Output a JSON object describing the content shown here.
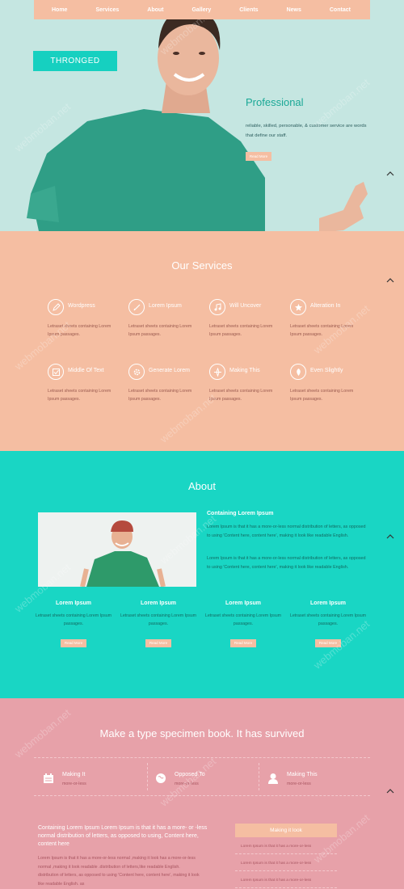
{
  "nav": [
    "Home",
    "Services",
    "About",
    "Gallery",
    "Clients",
    "News",
    "Contact"
  ],
  "hero": {
    "brand": "THRONGED",
    "title": "Professional",
    "text": "reliable, skilled, personable, & customer service are words that define our staff.",
    "button": "Read More"
  },
  "services": {
    "title": "Our Services",
    "items": [
      {
        "name": "Wordpress",
        "icon": "pencil-icon",
        "desc": "Letraset sheets containing Lorem Ipsum passages."
      },
      {
        "name": "Lorem Ipsum",
        "icon": "pen-icon",
        "desc": "Letraset sheets containing Lorem Ipsum passages."
      },
      {
        "name": "Will Uncover",
        "icon": "music-note-icon",
        "desc": "Letraset sheets containing Lorem Ipsum passages."
      },
      {
        "name": "Alteration In",
        "icon": "star-icon",
        "desc": "Letraset sheets containing Lorem Ipsum passages."
      },
      {
        "name": "Middle Of Text",
        "icon": "check-icon",
        "desc": "Letraset sheets containing Lorem Ipsum passages."
      },
      {
        "name": "Generate Lorem",
        "icon": "gear-icon",
        "desc": "Letraset sheets containing Lorem Ipsum passages."
      },
      {
        "name": "Making This",
        "icon": "compass-icon",
        "desc": "Letraset sheets containing Lorem Ipsum passages."
      },
      {
        "name": "Even Slightly",
        "icon": "leaf-icon",
        "desc": "Letraset sheets containing Lorem Ipsum passages."
      }
    ]
  },
  "about": {
    "title": "About",
    "subtitle": "Containing Lorem Ipsum",
    "para1": "Lorem Ipsum is that it has a more-or-less normal distribution of letters, as opposed to using 'Content here, content here', making it look like readable English.",
    "para2": "Lorem Ipsum is that it has a more-or-less normal distribution of letters, as opposed to using 'Content here, content here', making it look like readable English.",
    "columns": [
      {
        "title": "Lorem Ipsum",
        "desc": "Letraset sheets containing Lorem Ipsum passages.",
        "button": "Read More"
      },
      {
        "title": "Lorem Ipsum",
        "desc": "Letraset sheets containing Lorem Ipsum passages.",
        "button": "Read More"
      },
      {
        "title": "Lorem Ipsum",
        "desc": "Letraset sheets containing Lorem Ipsum passages.",
        "button": "Read More"
      },
      {
        "title": "Lorem Ipsum",
        "desc": "Letraset sheets containing Lorem Ipsum passages.",
        "button": "Read More"
      }
    ]
  },
  "specimen": {
    "title": "Make a type specimen book. It has survived",
    "features": [
      {
        "title": "Making It",
        "sub": "more-or-less",
        "icon": "calendar-icon"
      },
      {
        "title": "Opposed To",
        "sub": "more-or-less",
        "icon": "globe-icon"
      },
      {
        "title": "Making This",
        "sub": "more-or-less",
        "icon": "user-icon"
      }
    ],
    "lead": "Containing Lorem Ipsum Lorem Ipsum is that it has a more- or -less normal distribution of letters, as opposed to using, Content here, content here",
    "body": "Lorem Ipsum is that it has a more-or-less normal ,making it look has a more-or-less normal ,making it look readable .distribution of letters,like readable English. distribution of letters, as opposed to using 'Content here, content here', making it look like readable English. as",
    "sidebar": {
      "header": "Making it look",
      "items": [
        "Lorem Ipsum is that it has a more-or-less",
        "Lorem Ipsum is that it has a more-or-less",
        "Lorem Ipsum is that it has a more-or-less"
      ]
    }
  },
  "watermark": "webmoban.net"
}
